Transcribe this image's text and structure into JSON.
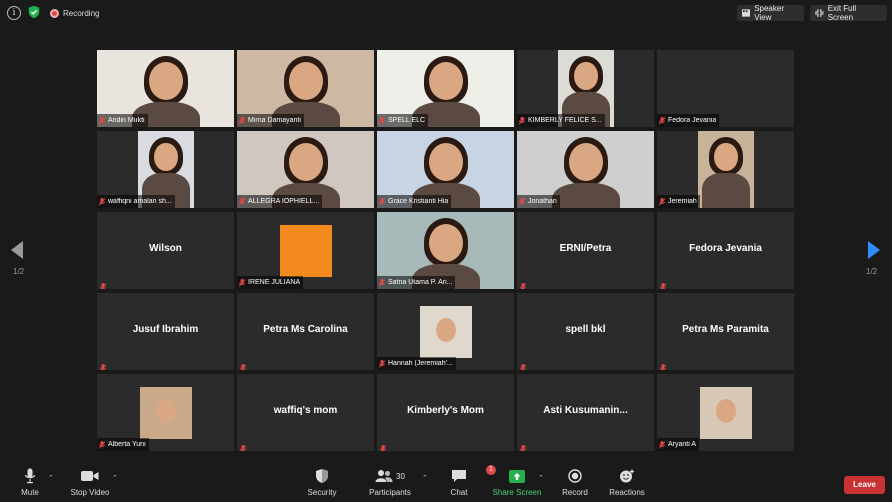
{
  "topbar": {
    "recording_label": "Recording",
    "speaker_view_label": "Speaker View",
    "exit_fullscreen_label": "Exit Full Screen"
  },
  "pagination": {
    "left": "1/2",
    "right": "1/2"
  },
  "tiles": [
    {
      "name": "Andin Mukti",
      "type": "video",
      "bg": "#e9e4de"
    },
    {
      "name": "Mirna Damayanti",
      "type": "video",
      "bg": "#cdb8a4"
    },
    {
      "name": "SPELL ELC",
      "type": "video",
      "bg": "#efefea",
      "active": true
    },
    {
      "name": "KIMBERLY FELICE S...",
      "type": "video",
      "bg": "#dcdcd6"
    },
    {
      "name": "Fedora Jevania",
      "type": "name"
    },
    {
      "name": "waffiqni amalan sh...",
      "type": "video",
      "bg": "#d9dbe0"
    },
    {
      "name": "ALLEGRA IOPHIELL...",
      "type": "video",
      "bg": "#d0c8c0"
    },
    {
      "name": "Grace Kristianti Hia",
      "type": "video",
      "bg": "#c7d4e3"
    },
    {
      "name": "Jonathan",
      "type": "video",
      "bg": "#cfcfcf"
    },
    {
      "name": "Jeremiah",
      "type": "video",
      "bg": "#c8b29a"
    },
    {
      "name": "Wilson",
      "type": "name_only"
    },
    {
      "name": "IRENE JULIANA",
      "type": "avatar",
      "bg": "#f28a1e"
    },
    {
      "name": "Satria Utama P. Ari...",
      "type": "video",
      "bg": "#a8b9b9"
    },
    {
      "name": "ERNI/Petra",
      "type": "name_only"
    },
    {
      "name": "Fedora Jevania",
      "type": "name_only"
    },
    {
      "name": "Jusuf Ibrahim",
      "type": "name_only"
    },
    {
      "name": "Petra Ms Carolina",
      "type": "name_only"
    },
    {
      "name": "Hannah (Jeremiah'...",
      "type": "avatar",
      "bg": "#dfd8cc"
    },
    {
      "name": "spell bkl",
      "type": "name_only"
    },
    {
      "name": "Petra Ms Paramita",
      "type": "name_only"
    },
    {
      "name": "Alberta Yuni",
      "type": "avatar",
      "bg": "#c9a98a"
    },
    {
      "name": "waffiq's mom",
      "type": "name_only"
    },
    {
      "name": "Kimberly's Mom",
      "type": "name_only"
    },
    {
      "name": "Asti  Kusumanin...",
      "type": "name_only"
    },
    {
      "name": "Aryanti A",
      "type": "avatar",
      "bg": "#d7c9b6"
    }
  ],
  "toolbar": {
    "mute_label": "Mute",
    "stop_video_label": "Stop Video",
    "security_label": "Security",
    "participants_label": "Participants",
    "participants_count": "30",
    "chat_label": "Chat",
    "chat_badge": "1",
    "share_screen_label": "Share Screen",
    "record_label": "Record",
    "reactions_label": "Reactions",
    "leave_label": "Leave"
  },
  "colors": {
    "active_speaker_border": "#b7d94a",
    "leave_button": "#c83232",
    "share_screen_green": "#4fd07a",
    "muted_mic_red": "#e04848",
    "next_arrow_blue": "#2d8cff"
  }
}
